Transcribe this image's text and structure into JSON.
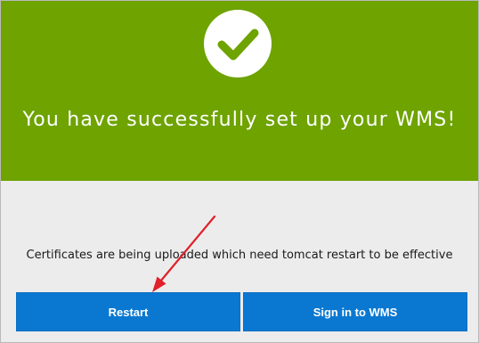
{
  "hero": {
    "title": "You have successfully set up your WMS!",
    "icon": "check-icon",
    "background_color": "#6ea300"
  },
  "message": "Certificates are being uploaded which need tomcat restart to be effective",
  "buttons": {
    "restart_label": "Restart",
    "signin_label": "Sign in to WMS",
    "color": "#0a78d1"
  },
  "annotation": {
    "icon": "red-arrow",
    "color": "#e0202a"
  }
}
